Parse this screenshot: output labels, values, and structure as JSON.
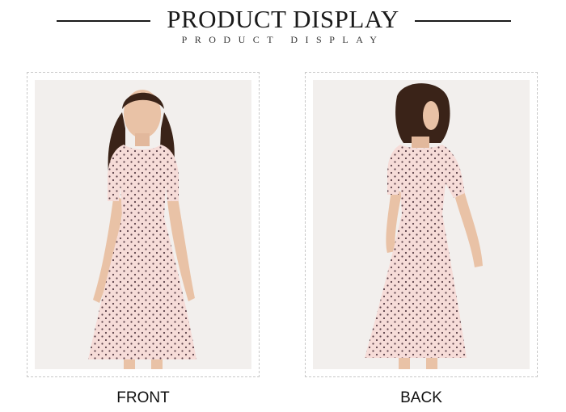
{
  "header": {
    "title": "PRODUCT DISPLAY",
    "subtitle": "PRODUCT DISPLAY"
  },
  "views": [
    {
      "caption": "FRONT"
    },
    {
      "caption": "BACK"
    }
  ],
  "colors": {
    "dress": "#f6dcd8",
    "dots": "#5a4048",
    "hair": "#3a2318",
    "skin": "#e9c2a6",
    "backdrop": "#f2efed"
  }
}
